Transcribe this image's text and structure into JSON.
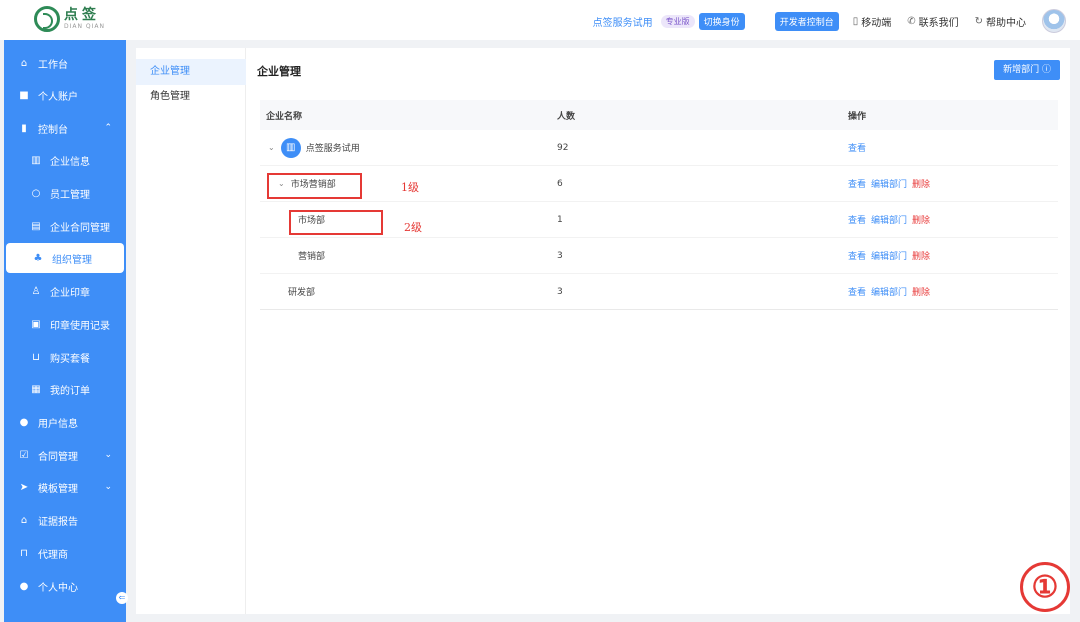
{
  "brand": {
    "name_cn": "点签",
    "name_en": "DIAN QIAN"
  },
  "header": {
    "service_name": "点签服务试用",
    "edition_badge": "专业版",
    "switch_label": "切换身份",
    "dev_button": "开发者控制台",
    "mobile_label": "移动端",
    "contact_label": "联系我们",
    "help_label": "帮助中心"
  },
  "sidebar": {
    "items": [
      {
        "label": "工作台",
        "icon": "home-icon"
      },
      {
        "label": "个人账户",
        "icon": "document-icon"
      },
      {
        "label": "控制台",
        "icon": "chart-icon",
        "chevron": "^"
      },
      {
        "label": "企业信息",
        "icon": "building-icon"
      },
      {
        "label": "员工管理",
        "icon": "user-icon"
      },
      {
        "label": "企业合同管理",
        "icon": "contract-icon"
      },
      {
        "label": "组织管理",
        "icon": "org-icon"
      },
      {
        "label": "企业印章",
        "icon": "seal-icon"
      },
      {
        "label": "印章使用记录",
        "icon": "record-icon"
      },
      {
        "label": "购买套餐",
        "icon": "cart-icon"
      },
      {
        "label": "我的订单",
        "icon": "order-icon"
      },
      {
        "label": "用户信息",
        "icon": "person-icon"
      },
      {
        "label": "合同管理",
        "icon": "check-icon",
        "chevron": "v"
      },
      {
        "label": "模板管理",
        "icon": "send-icon",
        "chevron": "v"
      },
      {
        "label": "证据报告",
        "icon": "evidence-icon"
      },
      {
        "label": "代理商",
        "icon": "agent-icon"
      },
      {
        "label": "个人中心",
        "icon": "account-icon"
      }
    ]
  },
  "subnav": {
    "items": [
      "企业管理",
      "角色管理"
    ]
  },
  "page": {
    "title": "企业管理",
    "add_button": "新增部门 ⓘ"
  },
  "table": {
    "headers": {
      "name": "企业名称",
      "count": "人数",
      "ops": "操作"
    },
    "rows": [
      {
        "name": "点签服务试用",
        "count": "92",
        "ops": [
          "查看"
        ]
      },
      {
        "name": "市场营销部",
        "count": "6",
        "ops": [
          "查看",
          "编辑部门",
          "删除"
        ]
      },
      {
        "name": "市场部",
        "count": "1",
        "ops": [
          "查看",
          "编辑部门",
          "删除"
        ]
      },
      {
        "name": "营销部",
        "count": "3",
        "ops": [
          "查看",
          "编辑部门",
          "删除"
        ]
      },
      {
        "name": "研发部",
        "count": "3",
        "ops": [
          "查看",
          "编辑部门",
          "删除"
        ]
      }
    ]
  },
  "annotations": {
    "level1": "1级",
    "level2": "2级",
    "step": "①"
  }
}
